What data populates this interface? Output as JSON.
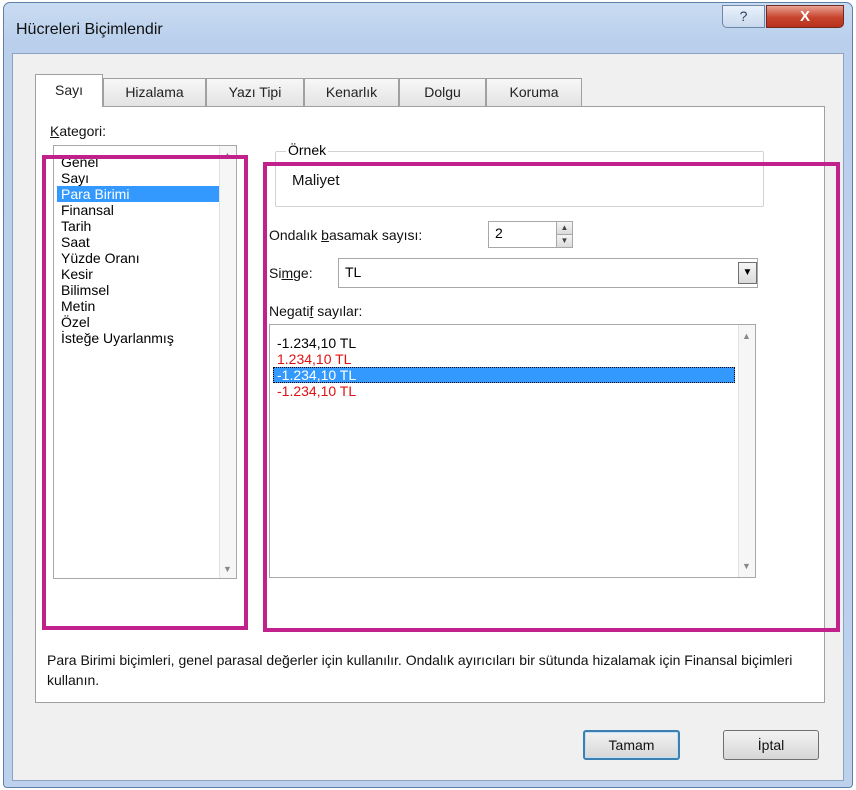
{
  "window": {
    "title": "Hücreleri Biçimlendir",
    "help_glyph": "?",
    "close_glyph": "X"
  },
  "tabs": [
    {
      "label": "Sayı",
      "active": true
    },
    {
      "label": "Hizalama"
    },
    {
      "label": "Yazı Tipi"
    },
    {
      "label": "Kenarlık"
    },
    {
      "label": "Dolgu"
    },
    {
      "label": "Koruma"
    }
  ],
  "category": {
    "label_prefix": "K",
    "label_rest": "ategori:",
    "items": [
      "Genel",
      "Sayı",
      "Para Birimi",
      "Finansal",
      "Tarih",
      "Saat",
      "Yüzde Oranı",
      "Kesir",
      "Bilimsel",
      "Metin",
      "Özel",
      "İsteğe Uyarlanmış"
    ],
    "selected": "Para Birimi"
  },
  "sample": {
    "title": "Örnek",
    "value": "Maliyet"
  },
  "decimal": {
    "label_pre": "Ondalık ",
    "label_u": "b",
    "label_post": "asamak sayısı:",
    "value": "2"
  },
  "symbol": {
    "label_pre": "Si",
    "label_u": "m",
    "label_post": "ge:",
    "value": "TL"
  },
  "negative": {
    "label_pre": "Negati",
    "label_u": "f",
    "label_post": " sayılar:",
    "items": [
      {
        "text": "-1.234,10 TL",
        "color": "#000000"
      },
      {
        "text": "1.234,10 TL",
        "color": "#e11111"
      },
      {
        "text": "-1.234,10 TL",
        "color": "#000000",
        "selected": true
      },
      {
        "text": "-1.234,10 TL",
        "color": "#e11111"
      }
    ]
  },
  "description": "Para Birimi biçimleri, genel parasal değerler için kullanılır. Ondalık ayırıcıları bir sütunda hizalamak için Finansal biçimleri kullanın.",
  "buttons": {
    "ok": "Tamam",
    "cancel": "İptal"
  },
  "colors": {
    "highlight": "#c0218a",
    "selection": "#3399ff",
    "negative_red": "#e11111"
  }
}
